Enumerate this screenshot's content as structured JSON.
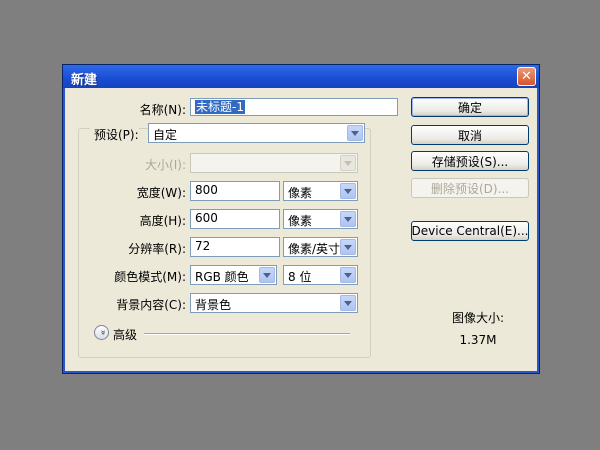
{
  "window": {
    "title": "新建",
    "close_symbol": "✕"
  },
  "form": {
    "name_label": "名称(N):",
    "name_value": "未标题-1",
    "preset_label": "预设(P):",
    "preset_value": "自定",
    "size_label": "大小(I):",
    "size_value": "",
    "width_label": "宽度(W):",
    "width_value": "800",
    "width_unit": "像素",
    "height_label": "高度(H):",
    "height_value": "600",
    "height_unit": "像素",
    "resolution_label": "分辨率(R):",
    "resolution_value": "72",
    "resolution_unit": "像素/英寸",
    "color_mode_label": "颜色模式(M):",
    "color_mode_value": "RGB 颜色",
    "bit_depth_value": "8 位",
    "background_label": "背景内容(C):",
    "background_value": "背景色",
    "advanced_label": "高级",
    "advanced_icon": "»"
  },
  "buttons": {
    "ok": "确定",
    "cancel": "取消",
    "save_preset": "存储预设(S)...",
    "delete_preset": "删除预设(D)...",
    "device_central": "Device Central(E)..."
  },
  "image_size": {
    "label": "图像大小:",
    "value": "1.37M"
  },
  "colors": {
    "titlebar": "#1b4fd3",
    "dialog_bg": "#ece9d8",
    "selection": "#316ac5"
  }
}
